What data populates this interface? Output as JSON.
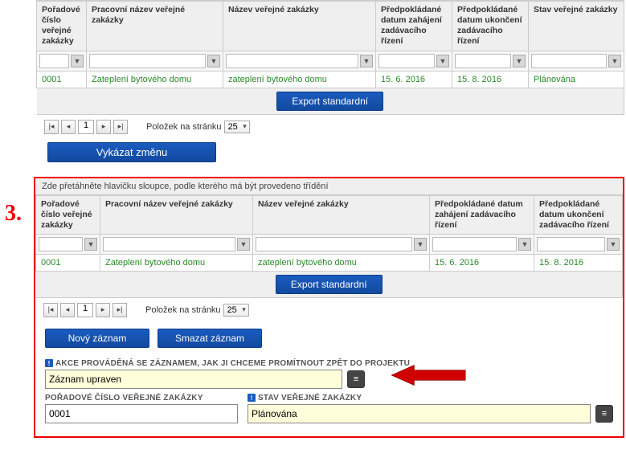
{
  "top_grid": {
    "headers": [
      "Pořadové číslo veřejné zakázky",
      "Pracovní název veřejné zakázky",
      "Název veřejné zakázky",
      "Předpokládané datum zahájení zadávacího řízení",
      "Předpokládané datum ukončení zadávacího řízení",
      "Stav veřejné zakázky"
    ],
    "row": [
      "0001",
      "Zateplení bytového domu",
      "zateplení bytového domu",
      "15. 6. 2016",
      "15. 8. 2016",
      "Plánována"
    ]
  },
  "bottom_grid": {
    "drag_hint": "Zde přetáhněte hlavičku sloupce, podle kterého má být provedeno třídění",
    "headers": [
      "Pořadové číslo veřejné zakázky",
      "Pracovní název veřejné zakázky",
      "Název veřejné zakázky",
      "Předpokládané datum zahájení zadávacího řízení",
      "Předpokládané datum ukončení zadávacího řízení"
    ],
    "row": [
      "0001",
      "Zateplení bytového domu",
      "zateplení bytového domu",
      "15. 6. 2016",
      "15. 8. 2016"
    ]
  },
  "buttons": {
    "export": "Export standardní",
    "vykazat": "Vykázat změnu",
    "novy": "Nový záznam",
    "smazat": "Smazat záznam"
  },
  "pager": {
    "page": "1",
    "label": "Položek na stránku",
    "size": "25"
  },
  "form": {
    "akce_label": "AKCE PROVÁDĚNÁ SE ZÁZNAMEM, JAK JI CHCEME PROMÍTNOUT ZPĚT DO PROJEKTU",
    "akce_value": "Záznam upraven",
    "poradove_label": "POŘADOVÉ ČÍSLO VEŘEJNÉ ZAKÁZKY",
    "poradove_value": "0001",
    "stav_label": "STAV VEŘEJNÉ ZAKÁZKY",
    "stav_value": "Plánována"
  },
  "annotation": {
    "num": "3."
  }
}
